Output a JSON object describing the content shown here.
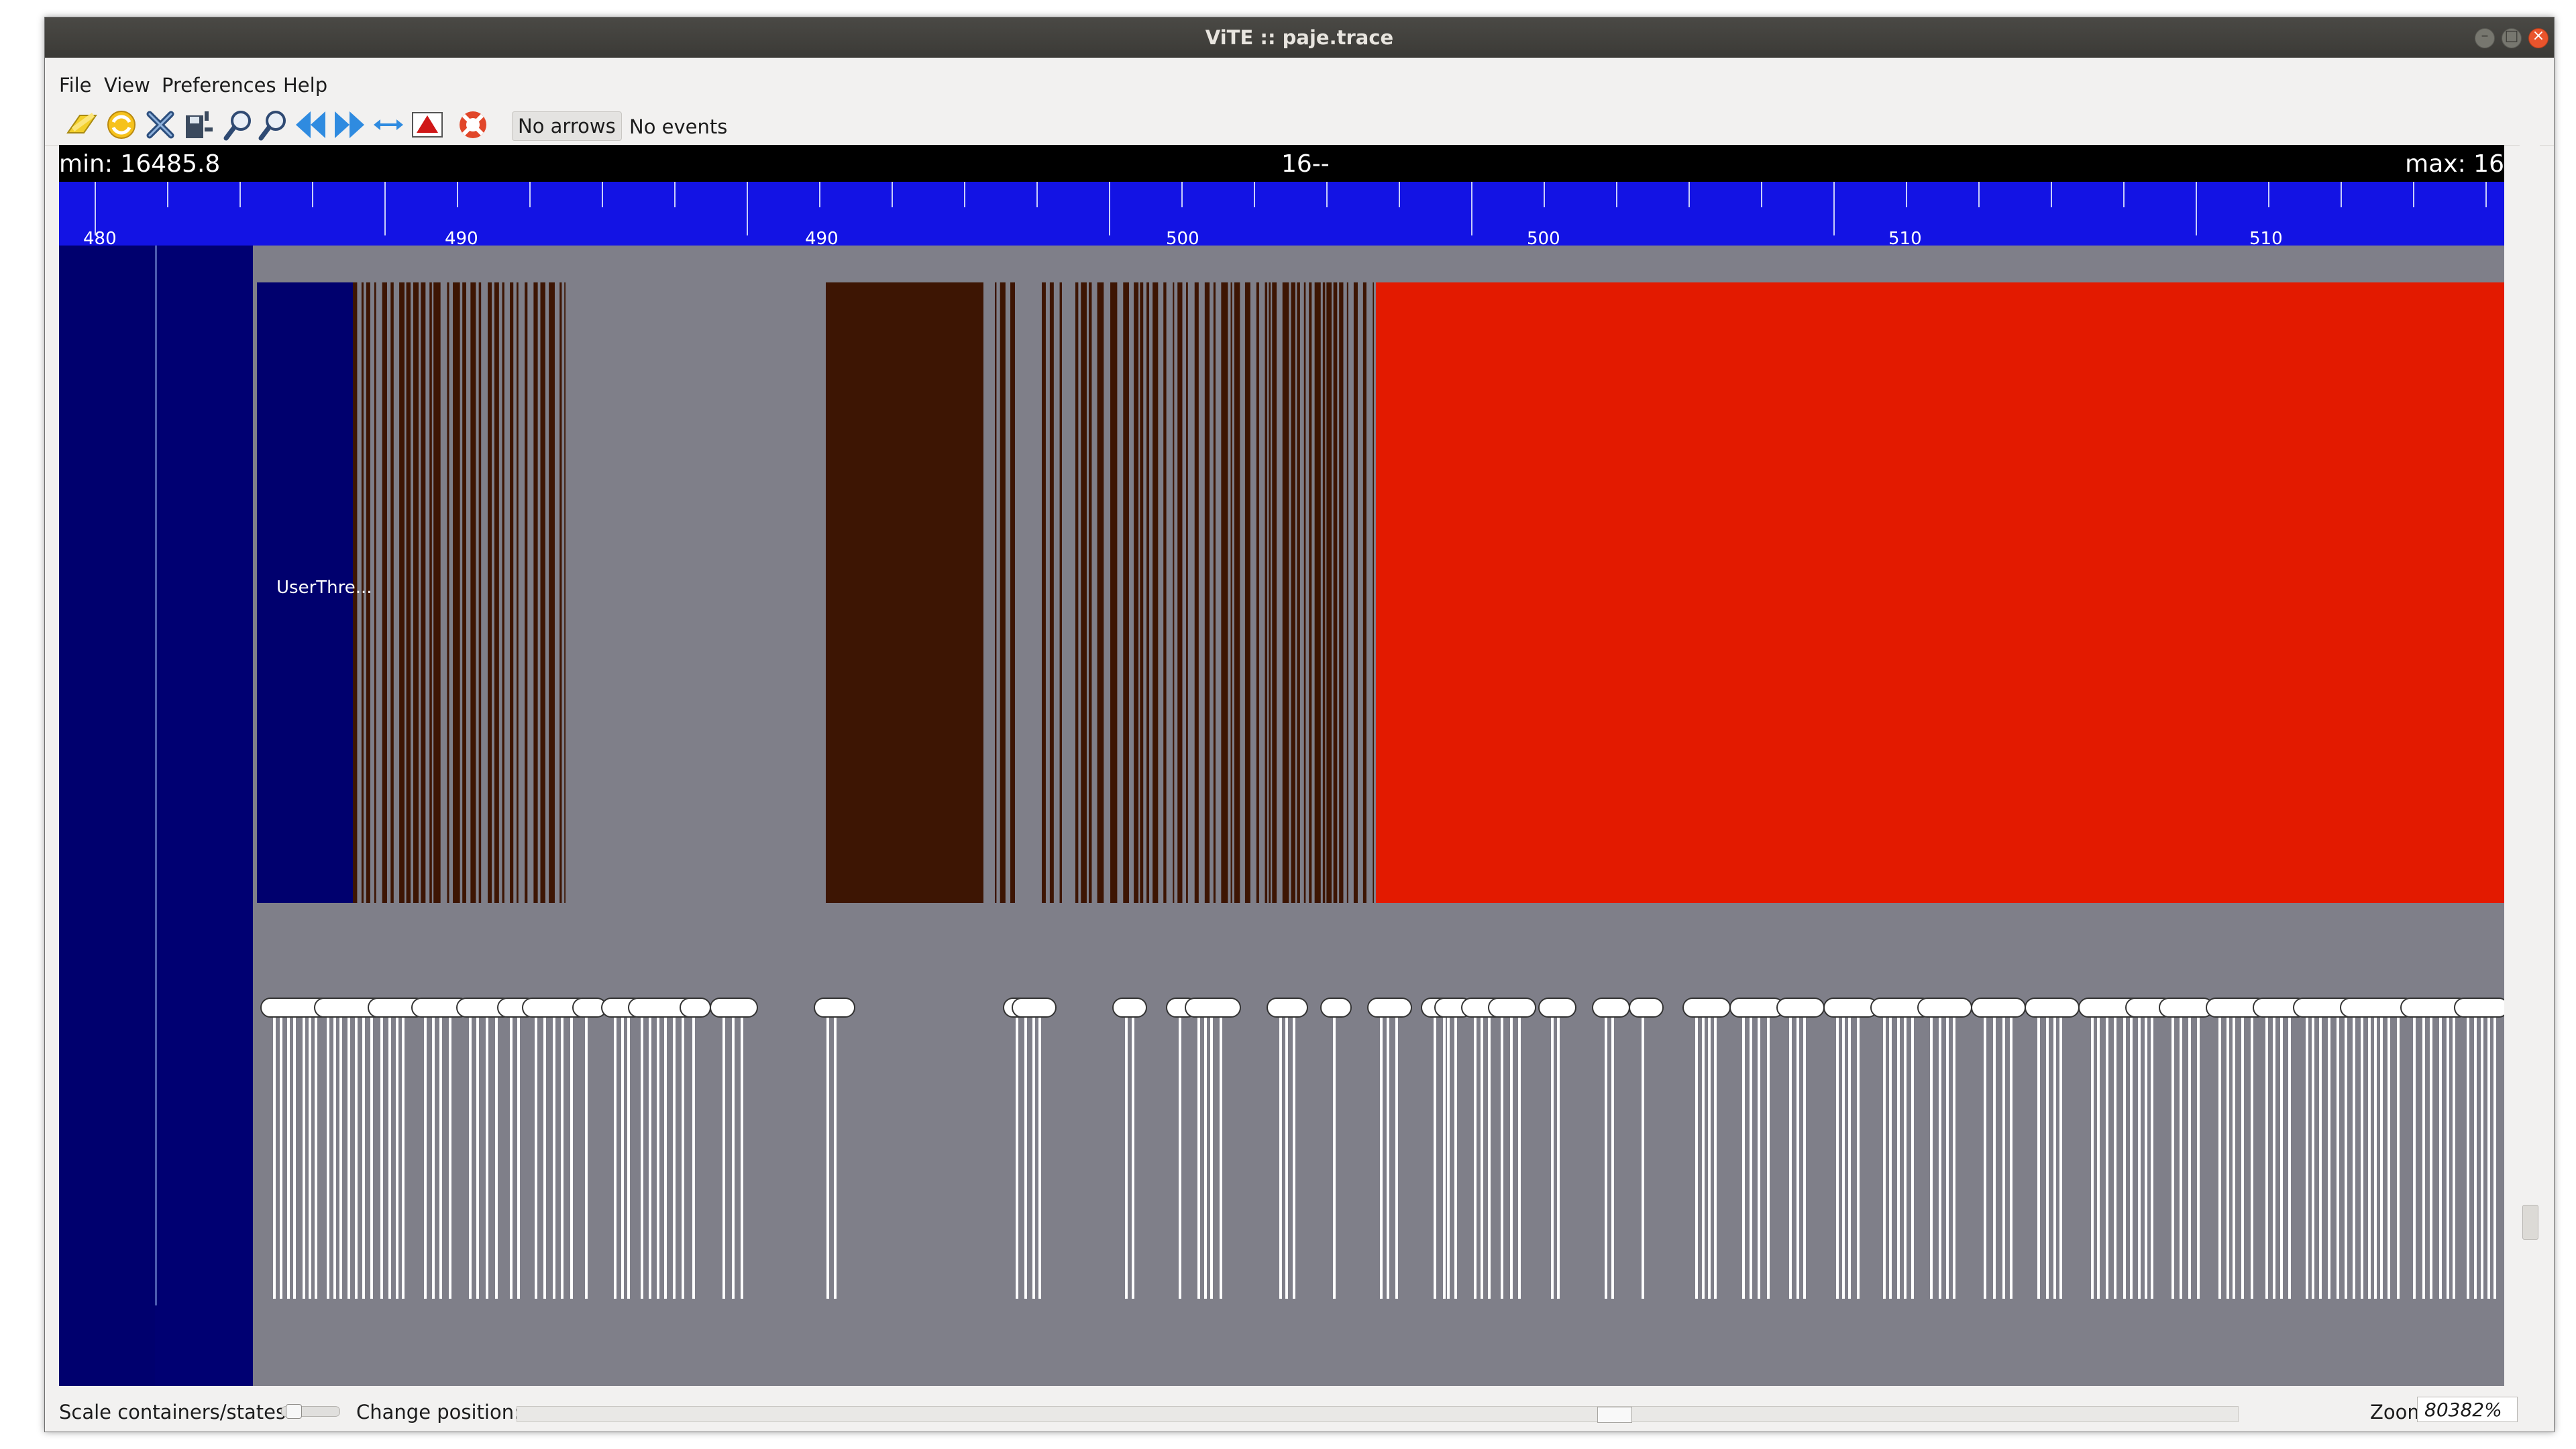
{
  "window": {
    "title": "ViTE :: paje.trace"
  },
  "menu": [
    "File",
    "View",
    "Preferences",
    "Help"
  ],
  "toolbar": {
    "icons": [
      "open-icon",
      "reload-icon",
      "close-trace-icon",
      "export-icon",
      "zoom-in-icon",
      "zoom-out-icon",
      "previous-icon",
      "next-icon",
      "fit-icon",
      "triangle-icon",
      "help-icon"
    ],
    "arrows_label": "No arrows",
    "events_label": "No events"
  },
  "trace": {
    "min_label": "min: 16485.8",
    "center_label": "16--",
    "max_label": "max: 16",
    "ruler_labels": [
      "480",
      "490",
      "490",
      "500",
      "500",
      "510",
      "510"
    ],
    "container_label": "UserThre...",
    "colors": {
      "background": "#7f7f89",
      "ruler": "#1313e4",
      "container": "#000072",
      "state_blue": "#00006e",
      "state_dark": "#3d1503",
      "state_red": "#e31a00",
      "event": "#ffffff"
    }
  },
  "status": {
    "scale_label": "Scale containers/states:",
    "position_label": "Change position:",
    "zoom_label": "Zoom:",
    "zoom_value": "80382%"
  }
}
